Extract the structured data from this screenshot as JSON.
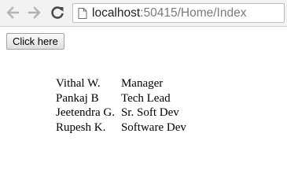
{
  "browser": {
    "url_host": "localhost",
    "url_rest": ":50415/Home/Index",
    "icons": {
      "back": "arrow-left-icon",
      "forward": "arrow-right-icon",
      "reload": "reload-icon",
      "page": "page-icon"
    }
  },
  "page": {
    "button_label": "Click here",
    "table": {
      "rows": [
        {
          "name": "Vithal W.",
          "role": "Manager"
        },
        {
          "name": "Pankaj B",
          "role": "Tech Lead"
        },
        {
          "name": "Jeetendra G.",
          "role": "Sr. Soft Dev"
        },
        {
          "name": "Rupesh K.",
          "role": "Software Dev"
        }
      ]
    }
  }
}
